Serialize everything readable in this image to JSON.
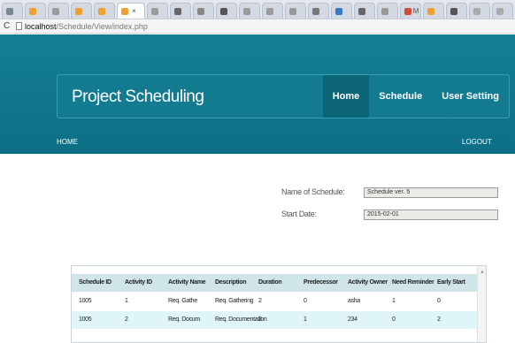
{
  "browser": {
    "tabs": [
      {
        "label": "",
        "color": "#7a8896"
      },
      {
        "label": "",
        "color": "#f0a030"
      },
      {
        "label": "",
        "color": "#9a9a9a"
      },
      {
        "label": "",
        "color": "#f0a030"
      },
      {
        "label": "",
        "color": "#f0a030"
      },
      {
        "label": "",
        "color": "#f0a030",
        "active": true,
        "close": "×"
      },
      {
        "label": "",
        "color": "#9a9a9a"
      },
      {
        "label": "",
        "color": "#666666"
      },
      {
        "label": "",
        "color": "#888888"
      },
      {
        "label": "",
        "color": "#555555"
      },
      {
        "label": "",
        "color": "#9a9a9a"
      },
      {
        "label": "",
        "color": "#9a9a9a"
      },
      {
        "label": "",
        "color": "#9a9a9a"
      },
      {
        "label": "",
        "color": "#777777"
      },
      {
        "label": "",
        "color": "#3a78c8"
      },
      {
        "label": "",
        "color": "#666666"
      },
      {
        "label": "",
        "color": "#9a9a9a"
      },
      {
        "label": "M",
        "color": "#d44a3a"
      },
      {
        "label": "",
        "color": "#f0a030"
      },
      {
        "label": "",
        "color": "#555555"
      },
      {
        "label": "",
        "color": "#aaaaaa"
      },
      {
        "label": "",
        "color": "#aaaaaa"
      }
    ],
    "url_host": "localhost",
    "url_path": "/Schedule/View/index.php"
  },
  "header": {
    "brand": "Project Scheduling",
    "nav": {
      "home": "Home",
      "schedule": "Schedule",
      "user_setting": "User Setting"
    },
    "subnav_home": "HOME",
    "subnav_logout": "LOGOUT"
  },
  "form": {
    "schedule_name_label": "Name of Schedule:",
    "schedule_name_value": "Schedule ver. 5",
    "start_date_label": "Start Date:",
    "start_date_value": "2015-02-01"
  },
  "table": {
    "headers": [
      "Schedule ID",
      "Activity ID",
      "Activity Name",
      "Description",
      "Duration",
      "Predecessor",
      "Activity Owner",
      "Need Reminder",
      "Early Start"
    ],
    "rows": [
      [
        "1005",
        "1",
        "Req. Gathe",
        "Req. Gathering",
        "2",
        "0",
        "asha",
        "1",
        "0"
      ],
      [
        "1005",
        "2",
        "Req. Docum",
        "Req. Documentation",
        "3",
        "1",
        "234",
        "0",
        "2"
      ]
    ]
  }
}
